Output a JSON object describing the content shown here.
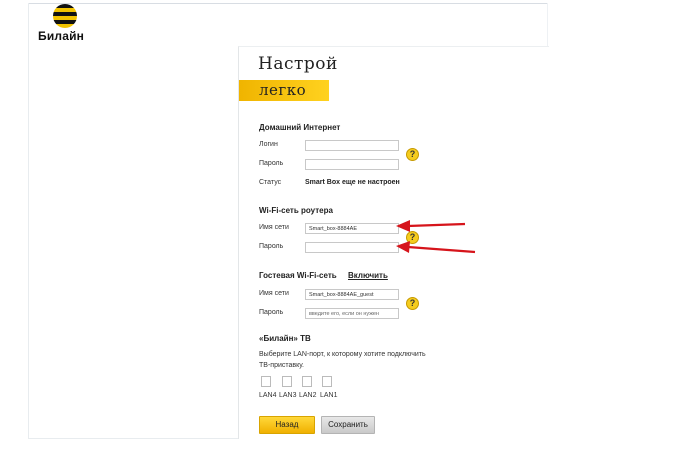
{
  "brand": {
    "name": "Билайн"
  },
  "header": {
    "title_line1": "Настрой",
    "title_line2": "легко"
  },
  "home_internet": {
    "title": "Домашний Интернет",
    "login_label": "Логин",
    "login_value": "",
    "password_label": "Пароль",
    "password_value": "",
    "status_label": "Статус",
    "status_value": "Smart Box еще не настроен"
  },
  "wifi": {
    "title": "Wi-Fi-сеть роутера",
    "ssid_label": "Имя сети",
    "ssid_value": "Smart_box-8884AE",
    "password_label": "Пароль",
    "password_value": ""
  },
  "guest_wifi": {
    "title": "Гостевая Wi-Fi-сеть",
    "enable_link": "Включить",
    "ssid_label": "Имя сети",
    "ssid_value": "Smart_box-8884AE_guest",
    "password_label": "Пароль",
    "password_placeholder": "введите его, если он нужен"
  },
  "tv": {
    "title": "«Билайн» ТВ",
    "description": "Выберите LAN-порт, к которому хотите подключить ТВ-приставку.",
    "ports": [
      "LAN4",
      "LAN3",
      "LAN2",
      "LAN1"
    ]
  },
  "buttons": {
    "back": "Назад",
    "save": "Сохранить"
  },
  "help_glyph": "?",
  "colors": {
    "accent": "#f5c400",
    "arrow": "#d6141b"
  }
}
